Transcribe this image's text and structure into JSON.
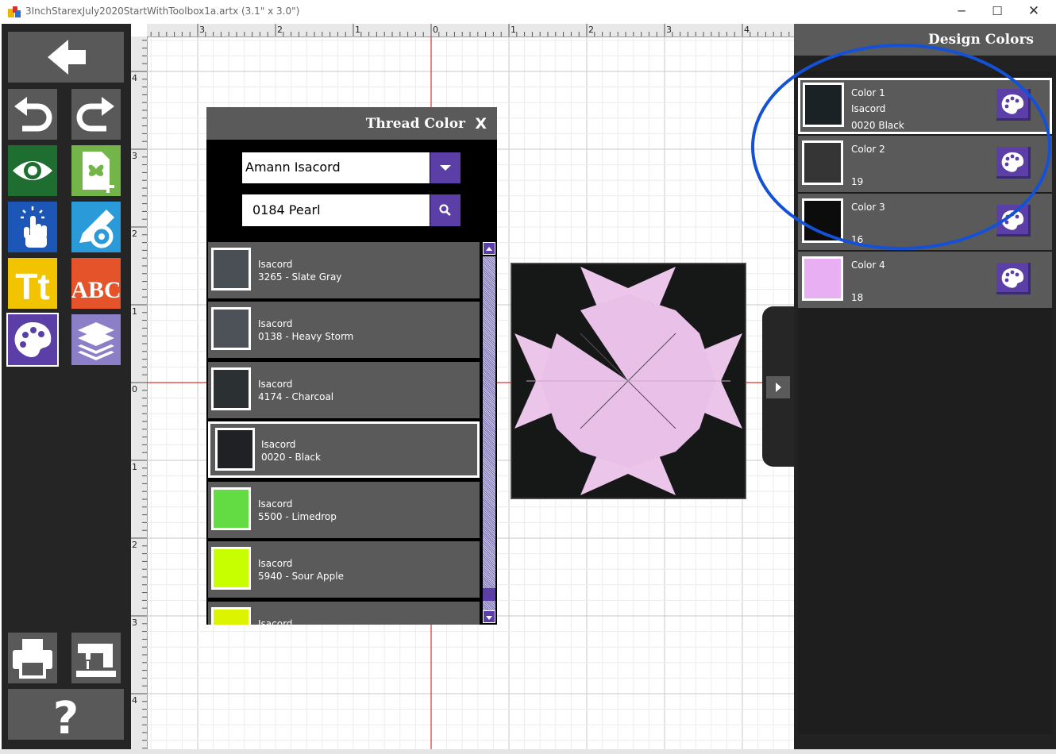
{
  "window": {
    "title": "3InchStarexJuly2020StartWithToolbox1a.artx (3.1\" x 3.0\")",
    "controls": [
      "minimize",
      "maximize",
      "close"
    ]
  },
  "toolbar": {
    "tools": [
      {
        "name": "back-button",
        "icon": "arrow-left-icon"
      },
      {
        "name": "undo-button",
        "icon": "undo-icon"
      },
      {
        "name": "redo-button",
        "icon": "redo-icon"
      },
      {
        "name": "view-button",
        "icon": "eye-icon"
      },
      {
        "name": "new-design-button",
        "icon": "butterfly-page-icon"
      },
      {
        "name": "select-button",
        "icon": "pointer-hand-icon"
      },
      {
        "name": "edit-settings-button",
        "icon": "pencil-gear-icon"
      },
      {
        "name": "lettering-button",
        "icon": "text-icon",
        "label": "Tt"
      },
      {
        "name": "monogram-button",
        "icon": "monogram-icon",
        "label": "ABC"
      },
      {
        "name": "thread-color-button",
        "icon": "palette-icon"
      },
      {
        "name": "layers-button",
        "icon": "layers-icon"
      },
      {
        "name": "print-button",
        "icon": "printer-icon"
      },
      {
        "name": "send-to-machine-button",
        "icon": "sewing-machine-icon"
      },
      {
        "name": "help-button",
        "icon": "question-icon",
        "label": "?"
      }
    ]
  },
  "rulers": {
    "top_labels": [
      "3",
      "2",
      "1",
      "0",
      "1",
      "2",
      "3",
      "4"
    ],
    "left_labels": [
      "4",
      "3",
      "2",
      "1",
      "0",
      "1",
      "2",
      "3",
      "4"
    ]
  },
  "thread_panel": {
    "title": "Thread Color",
    "close_label": "X",
    "brand_selected": "Amann Isacord",
    "search_value": "0184 Pearl",
    "threads": [
      {
        "brand": "Isacord",
        "label": "3265 - Slate Gray",
        "color": "#4a4f55",
        "selected": false
      },
      {
        "brand": "Isacord",
        "label": "0138 - Heavy Storm",
        "color": "#4d5258",
        "selected": false
      },
      {
        "brand": "Isacord",
        "label": "4174 - Charcoal",
        "color": "#2b3033",
        "selected": false
      },
      {
        "brand": "Isacord",
        "label": "0020 - Black",
        "color": "#1f2124",
        "selected": true
      },
      {
        "brand": "Isacord",
        "label": "5500 - Limedrop",
        "color": "#63dc43",
        "selected": false
      },
      {
        "brand": "Isacord",
        "label": "5940 - Sour Apple",
        "color": "#c8ff00",
        "selected": false
      },
      {
        "brand": "Isacord",
        "label": "",
        "color": "#dcf400",
        "selected": false
      }
    ]
  },
  "design_colors": {
    "title": "Design Colors",
    "colors": [
      {
        "name": "Color 1",
        "brand": "Isacord",
        "detail": "0020 Black",
        "color": "#1b2226",
        "selected": true
      },
      {
        "name": "Color 2",
        "brand": "",
        "detail": "19",
        "color": "#353535",
        "selected": false
      },
      {
        "name": "Color 3",
        "brand": "",
        "detail": "16",
        "color": "#0c0c0c",
        "selected": false
      },
      {
        "name": "Color 4",
        "brand": "",
        "detail": "18",
        "color": "#e8b0f2",
        "selected": false
      }
    ]
  },
  "accent_color": "#5b3fa6",
  "annotation_color": "#1451d6"
}
